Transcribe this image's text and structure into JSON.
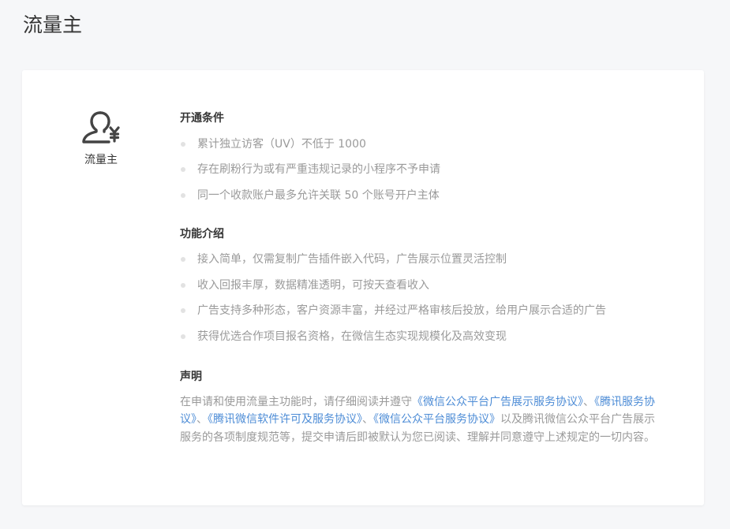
{
  "page": {
    "title": "流量主"
  },
  "identity": {
    "icon": "user-yuan-icon",
    "label": "流量主"
  },
  "sections": {
    "conditions": {
      "title": "开通条件",
      "items": [
        "累计独立访客（UV）不低于 1000",
        "存在刷粉行为或有严重违规记录的小程序不予申请",
        "同一个收款账户最多允许关联 50 个账号开户主体"
      ]
    },
    "features": {
      "title": "功能介绍",
      "items": [
        "接入简单，仅需复制广告插件嵌入代码，广告展示位置灵活控制",
        "收入回报丰厚，数据精准透明，可按天查看收入",
        "广告支持多种形态，客户资源丰富，并经过严格审核后投放，给用户展示合适的广告",
        "获得优选合作项目报名资格，在微信生态实现规模化及高效变现"
      ]
    },
    "statement": {
      "title": "声明",
      "text_before": "在申请和使用流量主功能时，请仔细阅读并遵守",
      "link1": "《微信公众平台广告展示服务协议》",
      "sep1": "、",
      "link2": "《腾讯服务协议》",
      "sep2": "、",
      "link3": "《腾讯微信软件许可及服务协议》",
      "sep3": "、",
      "link4": "《微信公众平台服务协议》",
      "text_after": "以及腾讯微信公众平台广告展示服务的各项制度规范等，提交申请后即被默认为您已阅读、理解并同意遵守上述规定的一切内容。"
    }
  },
  "colors": {
    "link": "#4d8cd6",
    "muted_text": "#9a9a9a",
    "text": "#353535",
    "background": "#f6f7f9"
  }
}
